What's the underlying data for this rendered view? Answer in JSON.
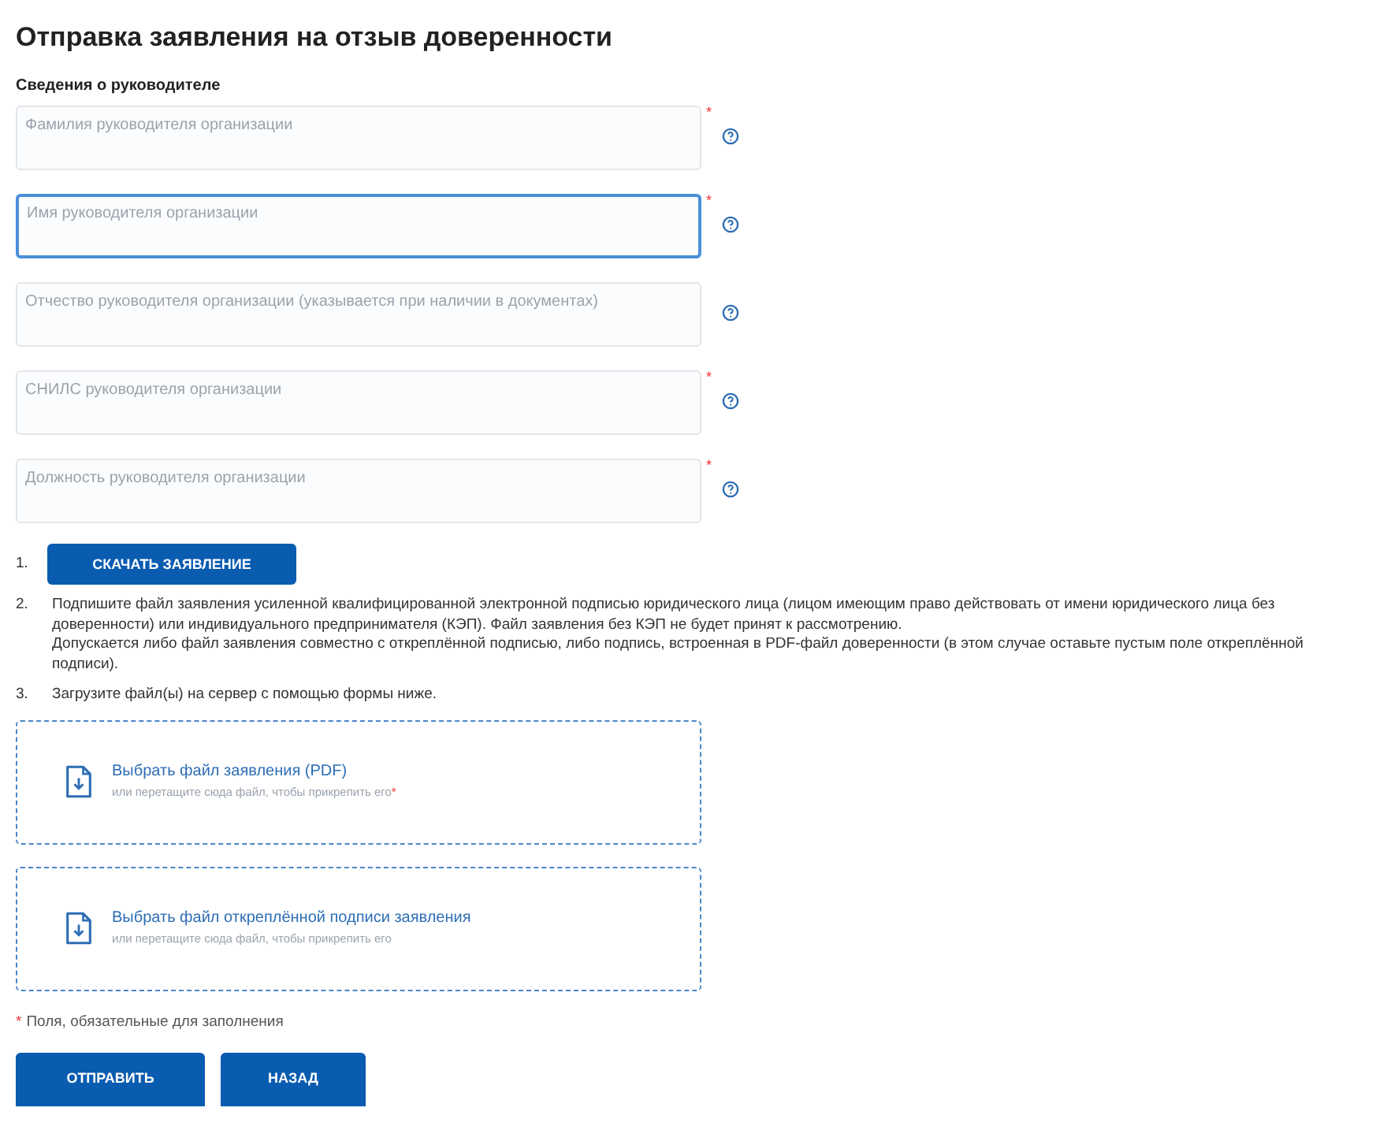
{
  "title": "Отправка заявления на отзыв доверенности",
  "section": "Сведения о руководителе",
  "fields": [
    {
      "placeholder": "Фамилия руководителя организации",
      "required": true,
      "focused": false
    },
    {
      "placeholder": "Имя руководителя организации",
      "required": true,
      "focused": true
    },
    {
      "placeholder": "Отчество руководителя организации (указывается при наличии в документах)",
      "required": false,
      "focused": false
    },
    {
      "placeholder": "СНИЛС руководителя организации",
      "required": true,
      "focused": false
    },
    {
      "placeholder": "Должность руководителя организации",
      "required": true,
      "focused": false
    }
  ],
  "steps": [
    {
      "number": "1.",
      "button": "СКАЧАТЬ ЗАЯВЛЕНИЕ"
    },
    {
      "number": "2.",
      "paragraphs": [
        "Подпишите файл заявления усиленной квалифицированной электронной подписью юридического лица (лицом имеющим право действовать от имени юридического лица без доверенности) или индивидуального предпринимателя (КЭП). Файл заявления без КЭП не будет принят к рассмотрению.",
        "Допускается либо файл заявления совместно с откреплённой подписью, либо подпись, встроенная в PDF-файл доверенности (в этом случае оставьте пустым поле откреплённой подписи)."
      ]
    },
    {
      "number": "3.",
      "paragraphs": [
        "Загрузите файл(ы) на сервер с помощью формы ниже."
      ]
    }
  ],
  "uploads": [
    {
      "title": "Выбрать файл заявления (PDF)",
      "hint": "или перетащите сюда файл, чтобы прикрепить его",
      "required": true
    },
    {
      "title": "Выбрать файл откреплённой подписи заявления",
      "hint": "или перетащите сюда файл, чтобы прикрепить его",
      "required": false
    }
  ],
  "required_note": "Поля, обязательные для заполнения",
  "required_mark": "*",
  "buttons": [
    "ОТПРАВИТЬ",
    "НАЗАД"
  ]
}
